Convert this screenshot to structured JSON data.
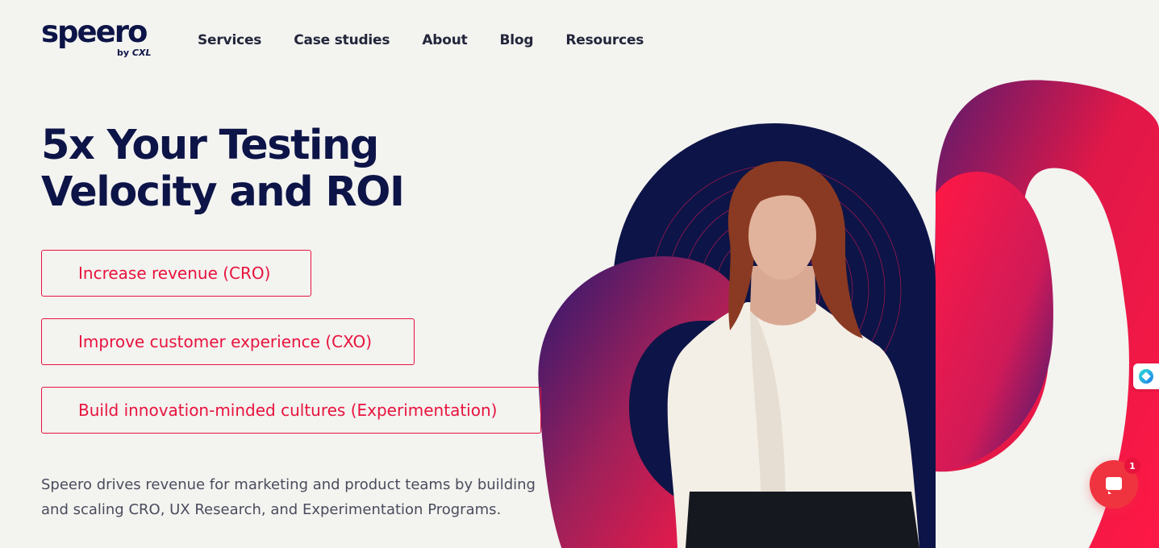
{
  "logo": {
    "word": "speero",
    "by": "by",
    "brand": "CXL"
  },
  "nav": {
    "items": [
      "Services",
      "Case studies",
      "About",
      "Blog",
      "Resources"
    ]
  },
  "hero": {
    "title_line1": "5x Your Testing",
    "title_line2": "Velocity and ROI",
    "ctas": [
      "Increase revenue (CRO)",
      "Improve customer experience (CXO)",
      "Build innovation-minded cultures (Experimentation)"
    ],
    "description": "Speero drives revenue for marketing and product teams by building and scaling CRO, UX Research, and Experimentation Programs."
  },
  "chat": {
    "badge_count": "1"
  },
  "colors": {
    "navy": "#0d1447",
    "accent": "#e8133d",
    "background": "#f3f3f0"
  },
  "icons": [
    "chat-bubble-icon",
    "assistant-widget-icon"
  ]
}
